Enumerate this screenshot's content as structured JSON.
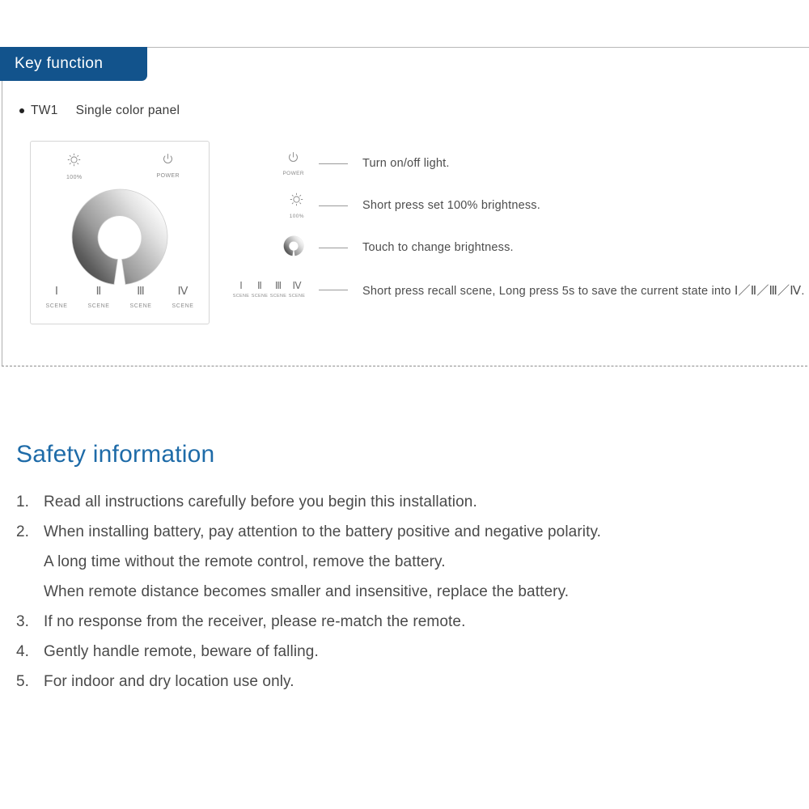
{
  "section": {
    "banner_title": "Key function",
    "model_bullet": "●",
    "model_code": "TW1",
    "model_desc": "Single color panel"
  },
  "panel": {
    "brightness_icon": "sun-brightness-icon",
    "brightness_label": "100%",
    "power_icon": "power-icon",
    "power_label": "POWER",
    "dimmer_ring": "touch-dimmer-ring",
    "scenes": [
      {
        "numeral": "Ⅰ",
        "label": "SCENE"
      },
      {
        "numeral": "Ⅱ",
        "label": "SCENE"
      },
      {
        "numeral": "Ⅲ",
        "label": "SCENE"
      },
      {
        "numeral": "Ⅳ",
        "label": "SCENE"
      }
    ]
  },
  "legend": {
    "rows": [
      {
        "icon": "power-icon",
        "icon_label": "POWER",
        "text": "Turn on/off light."
      },
      {
        "icon": "sun-brightness-icon",
        "icon_label": "100%",
        "text": "Short press set 100% brightness."
      },
      {
        "icon": "touch-dimmer-ring",
        "icon_label": "",
        "text": "Touch to change brightness."
      },
      {
        "icon": "scene-numerals",
        "icon_label": "",
        "text_before": "Short press recall scene, Long press 5s to save the current state into ",
        "text_roman": "Ⅰ／Ⅱ／Ⅲ／Ⅳ",
        "text_after": ".",
        "scenes": [
          {
            "numeral": "Ⅰ",
            "label": "SCENE"
          },
          {
            "numeral": "Ⅱ",
            "label": "SCENE"
          },
          {
            "numeral": "Ⅲ",
            "label": "SCENE"
          },
          {
            "numeral": "Ⅳ",
            "label": "SCENE"
          }
        ]
      }
    ]
  },
  "safety": {
    "title": "Safety information",
    "items": [
      {
        "number": "1.",
        "lines": [
          "Read all instructions carefully before you begin this installation."
        ]
      },
      {
        "number": "2.",
        "lines": [
          "When installing battery, pay attention to the battery positive and negative polarity.",
          "A long time without the remote control, remove the battery.",
          "When remote distance becomes smaller and insensitive, replace the battery."
        ]
      },
      {
        "number": "3.",
        "lines": [
          "If no response from the receiver, please re-match the remote."
        ]
      },
      {
        "number": "4.",
        "lines": [
          "Gently handle remote, beware of falling."
        ]
      },
      {
        "number": "5.",
        "lines": [
          "For indoor and dry location use only."
        ]
      }
    ]
  },
  "colors": {
    "banner_blue": "#12538c",
    "heading_blue": "#1e6ba8",
    "body_gray": "#4a4a4a",
    "rule_gray": "#b8b8b8",
    "ring_dark": "#4a4a4a",
    "ring_light": "#f2f2f2"
  }
}
